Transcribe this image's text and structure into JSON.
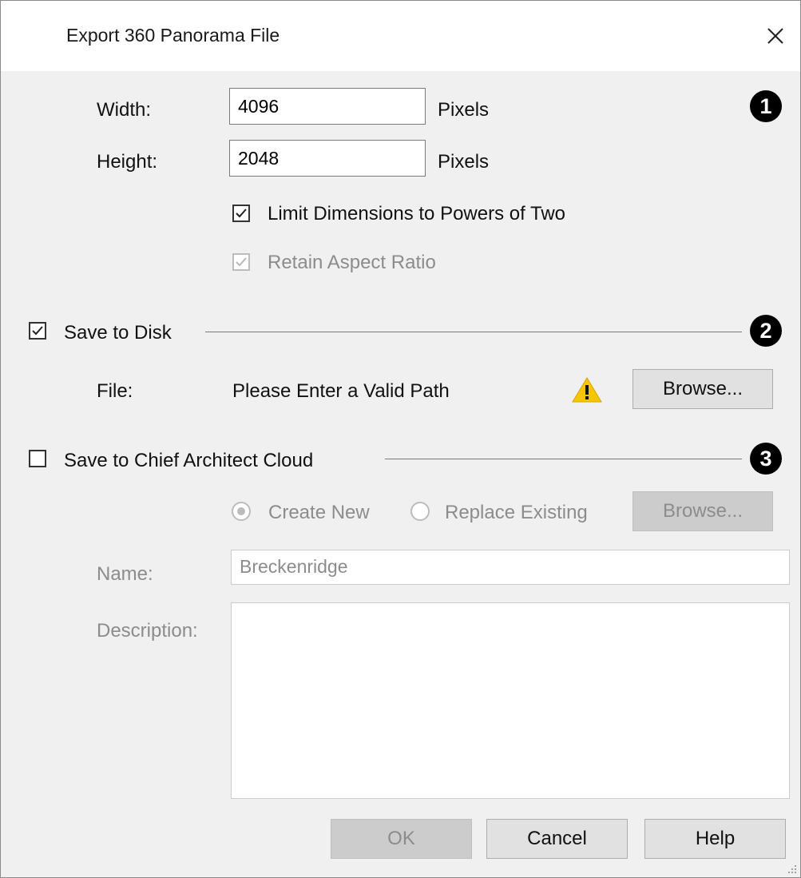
{
  "dialog": {
    "title": "Export 360 Panorama File"
  },
  "size": {
    "width_label": "Width:",
    "width_value": "4096",
    "width_unit": "Pixels",
    "height_label": "Height:",
    "height_value": "2048",
    "height_unit": "Pixels",
    "limit_powers_label": "Limit Dimensions to Powers of Two",
    "limit_powers_checked": true,
    "retain_aspect_label": "Retain Aspect Ratio",
    "retain_aspect_checked": true
  },
  "disk": {
    "label": "Save to Disk",
    "checked": true,
    "file_label": "File:",
    "file_value": "Please Enter a Valid Path",
    "browse_label": "Browse..."
  },
  "cloud": {
    "label": "Save to Chief Architect Cloud",
    "checked": false,
    "create_new_label": "Create New",
    "replace_existing_label": "Replace Existing",
    "browse_label": "Browse...",
    "name_label": "Name:",
    "name_value": "Breckenridge",
    "description_label": "Description:",
    "description_value": ""
  },
  "callouts": [
    "1",
    "2",
    "3"
  ],
  "footer": {
    "ok_label": "OK",
    "cancel_label": "Cancel",
    "help_label": "Help"
  },
  "icons": {
    "close": "close-icon",
    "warning": "warning-icon",
    "check": "checkmark-icon",
    "grip": "resize-grip-icon"
  },
  "colors": {
    "warning_fill": "#f7c600",
    "badge": "#000000"
  }
}
